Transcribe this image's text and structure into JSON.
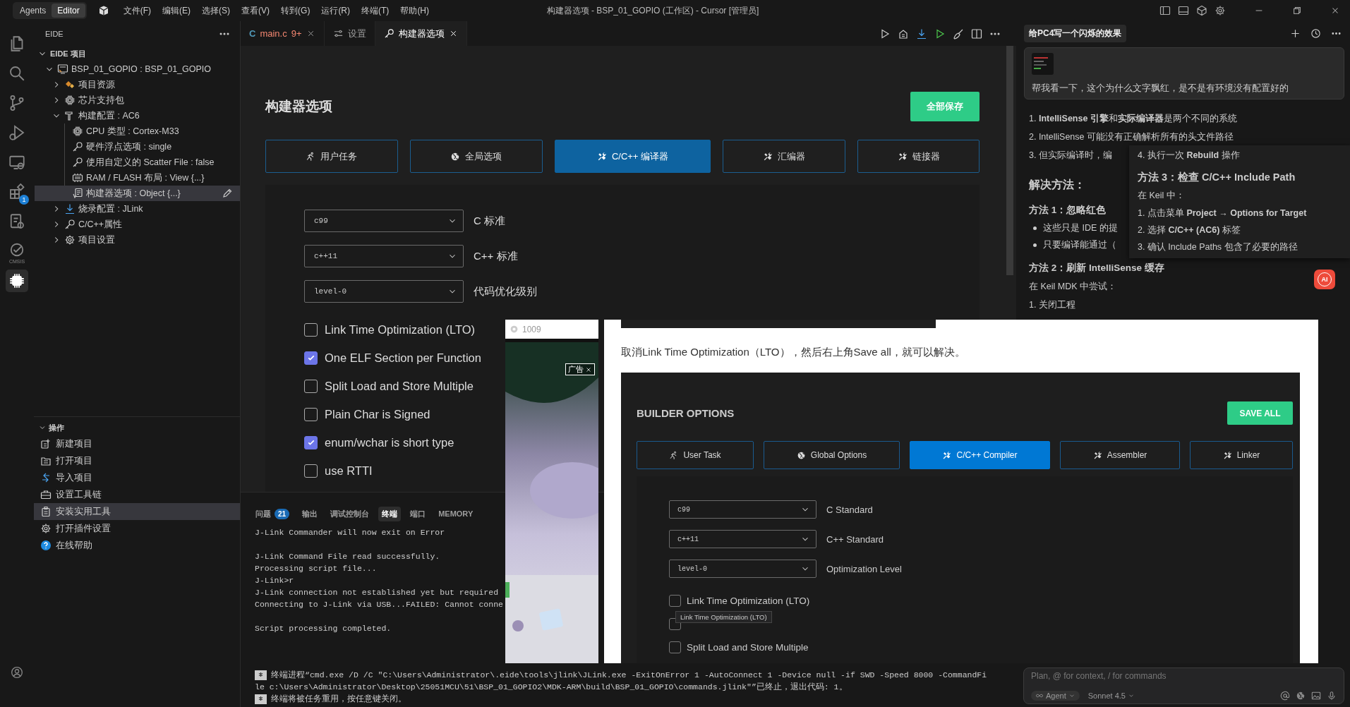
{
  "titlebar": {
    "modes": [
      {
        "label": "Agents",
        "selected": false
      },
      {
        "label": "Editor",
        "selected": true
      }
    ],
    "menu": [
      "文件(F)",
      "编辑(E)",
      "选择(S)",
      "查看(V)",
      "转到(G)",
      "运行(R)",
      "终端(T)",
      "帮助(H)"
    ],
    "title": "构建器选项 - BSP_01_GOPIO (工作区) - Cursor [管理员]"
  },
  "activity_bar": {
    "items": [
      {
        "kind": "files",
        "selected": false
      },
      {
        "kind": "search",
        "selected": false
      },
      {
        "kind": "scm",
        "selected": false
      },
      {
        "kind": "debug",
        "selected": false
      },
      {
        "kind": "remote",
        "selected": false
      },
      {
        "kind": "extensions",
        "selected": false,
        "badge": "1"
      },
      {
        "kind": "eide-tools",
        "selected": false
      },
      {
        "kind": "cmsis",
        "selected": false,
        "caption": "CMSIS"
      },
      {
        "kind": "chip",
        "selected": true
      }
    ]
  },
  "sidebar": {
    "title": "EIDE",
    "tree": [
      {
        "label": "EIDE 项目",
        "expanded": true,
        "selected": false,
        "children": [
          {
            "label": "BSP_01_GOPIO : BSP_01_GOPIO",
            "kind": "project",
            "expanded": true,
            "selected": false,
            "children": [
              {
                "label": "项目资源",
                "kind": "resources",
                "expanded": false,
                "selected": false
              },
              {
                "label": "芯片支持包",
                "kind": "chip",
                "expanded": false,
                "selected": false
              },
              {
                "label": "构建配置 : AC6",
                "kind": "hammer",
                "expanded": true,
                "selected": false,
                "children": [
                  {
                    "label": "CPU 类型 : Cortex-M33",
                    "kind": "chip",
                    "selected": false
                  },
                  {
                    "label": "硬件浮点选项 : single",
                    "kind": "key",
                    "selected": false
                  },
                  {
                    "label": "使用自定义的 Scatter File : false",
                    "kind": "key",
                    "selected": false
                  },
                  {
                    "label": "RAM / FLASH 布局 : View {...}",
                    "kind": "memory",
                    "selected": false
                  },
                  {
                    "label": "构建器选项 : Object {...}",
                    "kind": "options",
                    "selected": true
                  }
                ]
              },
              {
                "label": "烧录配置 : JLink",
                "kind": "download",
                "expanded": false,
                "selected": false
              },
              {
                "label": "C/C++属性",
                "kind": "key",
                "expanded": false,
                "selected": false
              },
              {
                "label": "项目设置",
                "kind": "gear",
                "expanded": false,
                "selected": false
              }
            ]
          }
        ]
      }
    ],
    "actions": {
      "title": "操作",
      "expanded": true,
      "items": [
        {
          "label": "新建项目",
          "kind": "new",
          "selected": false
        },
        {
          "label": "打开项目",
          "kind": "open",
          "selected": false
        },
        {
          "label": "导入项目",
          "kind": "import",
          "selected": false
        },
        {
          "label": "设置工具链",
          "kind": "toolbox",
          "selected": false
        },
        {
          "label": "安装实用工具",
          "kind": "install",
          "selected": true
        },
        {
          "label": "打开插件设置",
          "kind": "gear",
          "selected": false
        },
        {
          "label": "在线帮助",
          "kind": "help",
          "selected": false
        }
      ]
    }
  },
  "editor_tabs": [
    {
      "label": "main.c",
      "glyph": "C",
      "problems": "9+",
      "selected": false,
      "closable": true
    },
    {
      "label": "设置",
      "kind": "settings",
      "selected": false,
      "closable": false
    },
    {
      "label": "构建器选项",
      "kind": "key",
      "selected": true,
      "closable": true
    }
  ],
  "builder": {
    "title": "构建器选项",
    "save_label": "全部保存",
    "tabs": [
      {
        "label": "用户任务",
        "kind": "task",
        "selected": false
      },
      {
        "label": "全局选项",
        "kind": "globe",
        "selected": false
      },
      {
        "label": "C/C++ 编译器",
        "kind": "tools",
        "selected": true
      },
      {
        "label": "汇编器",
        "kind": "tools",
        "selected": false
      },
      {
        "label": "链接器",
        "kind": "tools",
        "selected": false
      }
    ],
    "selects": [
      {
        "value": "c99",
        "label": "C 标准"
      },
      {
        "value": "c++11",
        "label": "C++ 标准"
      },
      {
        "value": "level-0",
        "label": "代码优化级别"
      }
    ],
    "options": [
      {
        "label": "Link Time Optimization (LTO)",
        "checked": false
      },
      {
        "label": "One ELF Section per Function",
        "checked": true
      },
      {
        "label": "Split Load and Store Multiple",
        "checked": false
      },
      {
        "label": "Plain Char is Signed",
        "checked": false
      },
      {
        "label": "enum/wchar is short type",
        "checked": true
      },
      {
        "label": "use RTTI",
        "checked": false
      }
    ]
  },
  "panel": {
    "tabs": [
      {
        "label": "问题",
        "count": "21",
        "selected": false
      },
      {
        "label": "输出",
        "selected": false
      },
      {
        "label": "调试控制台",
        "selected": false
      },
      {
        "label": "终端",
        "selected": true
      },
      {
        "label": "端口",
        "selected": false
      },
      {
        "label": "MEMORY",
        "selected": false
      }
    ],
    "terminal": {
      "blocks": [
        [
          "J-Link Commander will now exit on Error"
        ],
        [
          "J-Link Command File read successfully.",
          "Processing script file...",
          "J-Link>r",
          "J-Link connection not established yet but required",
          "Connecting to J-Link via USB...FAILED: Cannot conne"
        ],
        [
          "Script processing completed."
        ]
      ],
      "notices": [
        {
          "lines": [
            "终端进程“cmd.exe /D /C \"C:\\Users\\Administrator\\.eide\\tools\\jlink\\JLink.exe -ExitOnError 1 -AutoConnect 1 -Device null -if SWD -Speed 8000 -CommandFi",
            "le c:\\Users\\Administrator\\Desktop\\25051MCU\\51\\BSP_01_GOPIO2\\MDK-ARM\\build\\BSP_01_GOPIO\\commands.jlink\"”已终止，退出代码: 1。"
          ]
        },
        {
          "lines": [
            "终端将被任务重用，按任意键关闭。"
          ]
        }
      ]
    }
  },
  "chat": {
    "tab": "给PC4写一个闪烁的效果",
    "message": {
      "text": "帮我看一下，这个为什么文字飘红，是不是有环境没有配置好的"
    },
    "content": [
      {
        "kind": "ol",
        "items": [
          "1. **IntelliSense 引擎**和**实际编译器**是两个不同的系统",
          "2. IntelliSense 可能没有正确解析所有的头文件路径",
          "3. 但实际编译时，编"
        ]
      },
      {
        "kind": "h2",
        "text": "解决方法："
      },
      {
        "kind": "h3",
        "text": "方法 1：忽略红色"
      },
      {
        "kind": "ul",
        "items": [
          "这些只是 IDE 的提",
          "只要编译能通过（"
        ]
      },
      {
        "kind": "h3",
        "text": "方法 2：刷新 IntelliSense 缓存"
      },
      {
        "kind": "p",
        "text": "在 Keil MDK 中尝试："
      },
      {
        "kind": "ol",
        "items": [
          "1. 关闭工程"
        ]
      }
    ],
    "popup": [
      {
        "kind": "li",
        "text": "4. 执行一次 **Rebuild** 操作"
      },
      {
        "kind": "h3",
        "text": "方法 3：检查 C/C++ Include Path"
      },
      {
        "kind": "p",
        "text": "在 Keil 中："
      },
      {
        "kind": "li",
        "text": "1. 点击菜单 **Project → Options for Target**"
      },
      {
        "kind": "li",
        "text": "2. 选择 **C/C++ (AC6)** 标签"
      },
      {
        "kind": "li",
        "text": "3. 确认 Include Paths 包含了必要的路径"
      }
    ],
    "ai_badge": "AI",
    "input": {
      "placeholder": "Plan, @ for context, / for commands",
      "mode": "Agent",
      "model": "Sonnet 4.5"
    }
  },
  "ad": {
    "views": "1009",
    "label": "广告",
    "kind": "picture"
  },
  "article": {
    "caption": "取消Link Time Optimization（LTO），然后右上角Save all，就可以解决。",
    "shot": {
      "title": "BUILDER OPTIONS",
      "save_label": "SAVE ALL",
      "tabs": [
        {
          "label": "User Task",
          "kind": "task",
          "selected": false
        },
        {
          "label": "Global Options",
          "kind": "globe",
          "selected": false
        },
        {
          "label": "C/C++ Compiler",
          "kind": "tools",
          "selected": true
        },
        {
          "label": "Assembler",
          "kind": "tools",
          "selected": false
        },
        {
          "label": "Linker",
          "kind": "tools",
          "selected": false
        }
      ],
      "selects": [
        {
          "value": "c99",
          "label": "C Standard"
        },
        {
          "value": "c++11",
          "label": "C++ Standard"
        },
        {
          "value": "level-0",
          "label": "Optimization Level"
        }
      ],
      "options": [
        {
          "label": "Link Time Optimization (LTO)",
          "checked": false
        },
        {
          "checked": false
        },
        {
          "label": "Split Load and Store Multiple",
          "checked": false
        }
      ],
      "tooltip": "Link Time Optimization (LTO)"
    }
  }
}
